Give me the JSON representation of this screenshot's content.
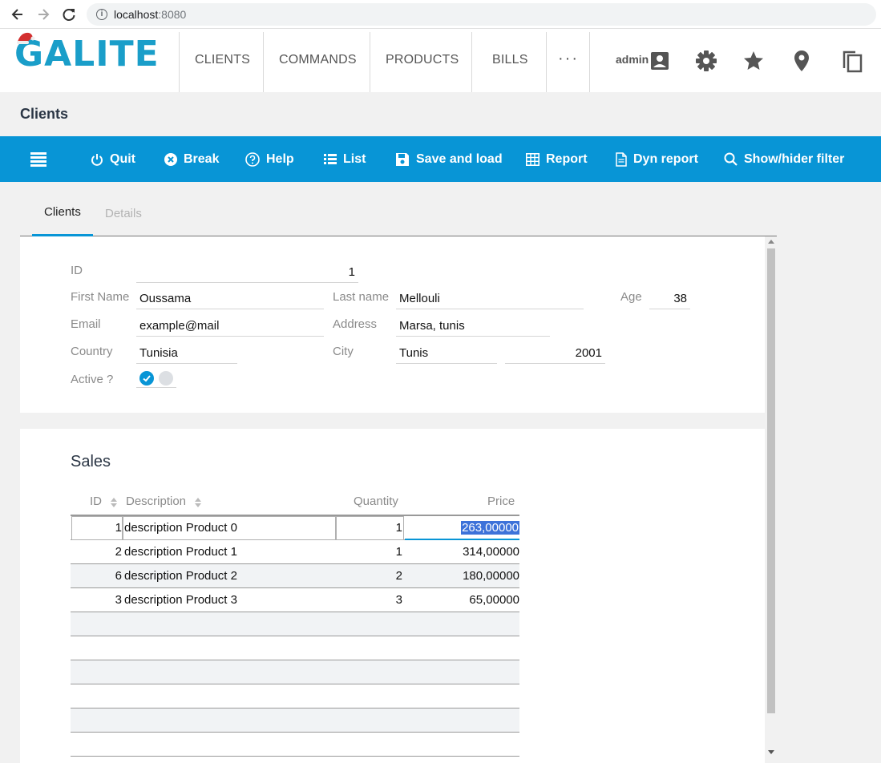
{
  "browser": {
    "url_host": "localhost",
    "url_port": ":8080"
  },
  "header": {
    "logo_text": "GALITE",
    "menu": [
      "CLIENTS",
      "COMMANDS",
      "PRODUCTS",
      "BILLS"
    ],
    "more": "···",
    "user": "admin",
    "icons": [
      "account-box-icon",
      "gear-icon",
      "star-icon",
      "location-pin-icon",
      "copy-icon"
    ]
  },
  "page_title": "Clients",
  "toolbar": {
    "quit": "Quit",
    "break": "Break",
    "help": "Help",
    "list": "List",
    "save_and_load": "Save and load",
    "report": "Report",
    "dyn_report": "Dyn report",
    "filter": "Show/hider filter"
  },
  "tabs": {
    "clients": "Clients",
    "details": "Details"
  },
  "form": {
    "id_label": "ID",
    "id_value": "1",
    "first_name_label": "First Name",
    "first_name_value": "Oussama",
    "last_name_label": "Last name",
    "last_name_value": "Mellouli",
    "age_label": "Age",
    "age_value": "38",
    "email_label": "Email",
    "email_value": "example@mail",
    "address_label": "Address",
    "address_value": "Marsa, tunis",
    "country_label": "Country",
    "country_value": "Tunisia",
    "city_label": "City",
    "city_value": "Tunis",
    "zip_value": "2001",
    "active_label": "Active ?",
    "active": true
  },
  "sales": {
    "title": "Sales",
    "columns": {
      "id": "ID",
      "description": "Description",
      "quantity": "Quantity",
      "price": "Price"
    },
    "rows": [
      {
        "id": "1",
        "description": "description Product 0",
        "quantity": "1",
        "price": "263,00000"
      },
      {
        "id": "2",
        "description": "description Product 1",
        "quantity": "1",
        "price": "314,00000"
      },
      {
        "id": "6",
        "description": "description Product 2",
        "quantity": "2",
        "price": "180,00000"
      },
      {
        "id": "3",
        "description": "description Product 3",
        "quantity": "3",
        "price": "65,00000"
      }
    ]
  },
  "colors": {
    "accent": "#0895d6",
    "selection": "#3d72d9"
  }
}
